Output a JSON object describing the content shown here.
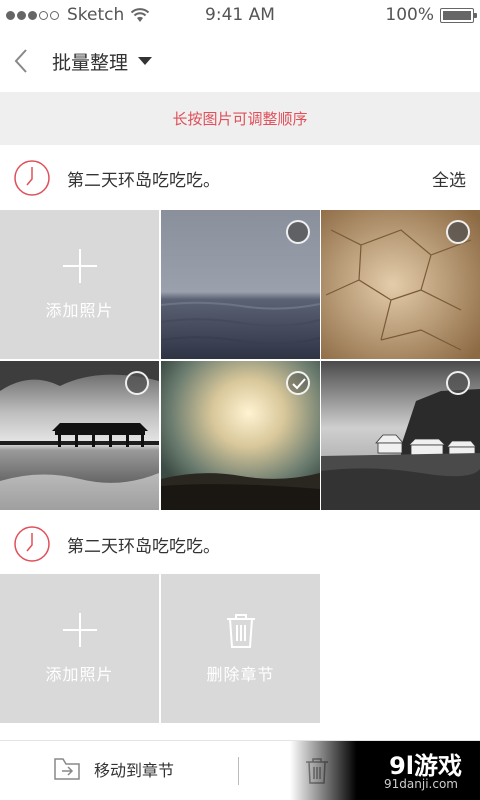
{
  "status_bar": {
    "carrier": "Sketch",
    "time": "9:41 AM",
    "battery": "100%",
    "signal_bars_filled": 3,
    "signal_bars_total": 5
  },
  "nav": {
    "title": "批量整理",
    "back_icon": "chevron-left-icon",
    "dropdown_icon": "caret-down-icon"
  },
  "hint": "长按图片可调整顺序",
  "sections": [
    {
      "title": "第二天环岛吃吃吃。",
      "select_all": "全选",
      "add_label": "添加照片",
      "photos": [
        {
          "scene": "foggy-sea",
          "checked": false
        },
        {
          "scene": "cracked-earth",
          "checked": false
        },
        {
          "scene": "pier-bw",
          "checked": false
        },
        {
          "scene": "sunset-sky",
          "checked": true
        },
        {
          "scene": "cliff-houses-bw",
          "checked": false
        }
      ]
    },
    {
      "title": "第二天环岛吃吃吃。",
      "add_label": "添加照片",
      "delete_label": "删除章节"
    }
  ],
  "bottom_bar": {
    "move_label": "移动到章节"
  },
  "watermark": {
    "logo": "9l游戏",
    "url": "91danji.com"
  },
  "colors": {
    "accent": "#e0505a",
    "placeholder_bg": "#d9d9d9",
    "hint_bg": "#efefef"
  }
}
